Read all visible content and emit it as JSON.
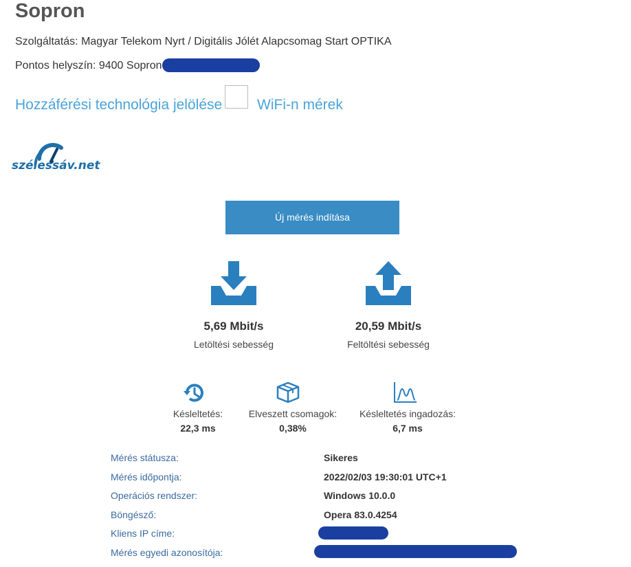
{
  "page": {
    "title": "Sopron"
  },
  "service": {
    "label": "Szolgáltatás:",
    "value": "Magyar Telekom Nyrt / Digitális Jólét Alapcsomag Start OPTIKA"
  },
  "location": {
    "label": "Pontos helyszín:",
    "value": "9400 Sopron"
  },
  "links": {
    "access_tech": "Hozzáférési technológia jelölése",
    "wifi": "WiFi-n mérek"
  },
  "wifi_checkbox": {
    "checked": false
  },
  "logo": {
    "text": "szélessáv.net"
  },
  "start_button": {
    "label": "Új mérés indítása"
  },
  "download": {
    "value": "5,69 Mbit/s",
    "label": "Letöltési sebesség",
    "icon": "download-tray-icon"
  },
  "upload": {
    "value": "20,59 Mbit/s",
    "label": "Feltöltési sebesség",
    "icon": "upload-tray-icon"
  },
  "metrics": [
    {
      "label": "Késleltetés:",
      "value": "22,3 ms",
      "icon": "history-clock-icon"
    },
    {
      "label": "Elveszett csomagok:",
      "value": "0,38%",
      "icon": "package-box-icon"
    },
    {
      "label": "Késleltetés ingadozás:",
      "value": "6,7 ms",
      "icon": "jitter-chart-icon"
    }
  ],
  "details": [
    {
      "label": "Mérés státusza:",
      "value": "Sikeres"
    },
    {
      "label": "Mérés időpontja:",
      "value": "2022/02/03 19:30:01 UTC+1"
    },
    {
      "label": "Operációs rendszer:",
      "value": "Windows 10.0.0"
    },
    {
      "label": "Böngésző:",
      "value": "Opera 83.0.4254"
    },
    {
      "label": "Kliens IP címe:",
      "value": ""
    },
    {
      "label": "Mérés egyedi azonosítója:",
      "value": ""
    }
  ],
  "colors": {
    "accent": "#3a8cc4",
    "link": "#4aa3d8",
    "detail_label": "#3a6aa0",
    "redaction": "#1a3fa0",
    "title": "#555555"
  }
}
